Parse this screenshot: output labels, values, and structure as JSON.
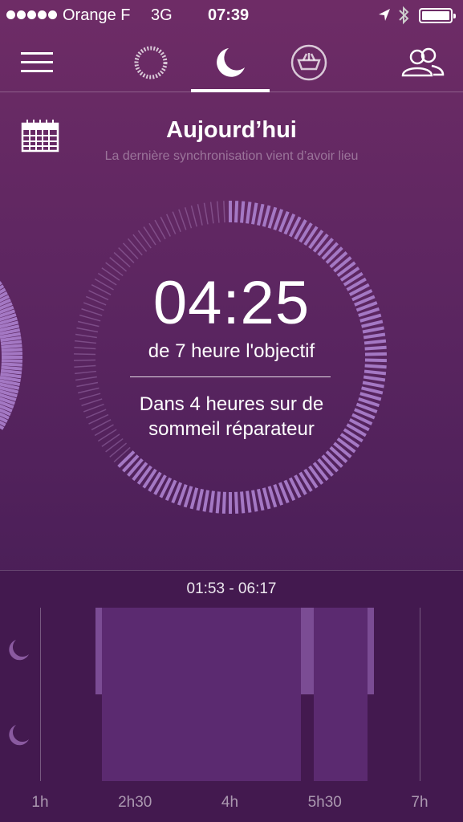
{
  "status_bar": {
    "carrier": "Orange F",
    "network": "3G",
    "time": "07:39"
  },
  "nav": {
    "active_tab": "sleep",
    "tabs": [
      "menu",
      "activity",
      "sleep",
      "meal",
      "friends"
    ]
  },
  "header": {
    "title": "Aujourd’hui",
    "sync_status": "La dernière synchronisation vient d’avoir lieu"
  },
  "summary": {
    "total_sleep": "04:25",
    "goal_text": "de 7 heure l'objectif",
    "deep_sleep_text": "Dans 4 heures sur de sommeil réparateur",
    "goal_fraction": 0.631
  },
  "chart": {
    "range_label": "01:53 - 06:17",
    "x_ticks": [
      "1h",
      "2h30",
      "4h",
      "5h30",
      "7h"
    ],
    "accent_light": "#7b4c94",
    "accent_deep": "#5b2a70"
  },
  "chart_data": {
    "type": "bar",
    "x_unit": "hours",
    "x_ticks": [
      "1h",
      "2h30",
      "4h",
      "5h30",
      "7h"
    ],
    "xlim": [
      1,
      7
    ],
    "series": [],
    "segments": [
      {
        "start": 1.88,
        "end": 1.98,
        "stage": "light"
      },
      {
        "start": 1.98,
        "end": 5.12,
        "stage": "deep"
      },
      {
        "start": 5.12,
        "end": 5.32,
        "stage": "light"
      },
      {
        "start": 5.32,
        "end": 6.18,
        "stage": "deep"
      },
      {
        "start": 6.18,
        "end": 6.28,
        "stage": "light"
      }
    ]
  }
}
